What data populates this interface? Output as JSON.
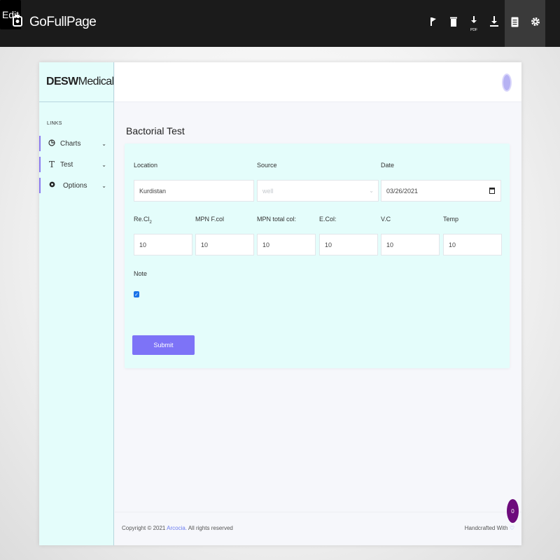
{
  "toolbar": {
    "brand": "GoFullPage",
    "edit_label": "Edit",
    "pdf_label": "PDF",
    "icons": [
      "camera-icon",
      "flag-icon",
      "trash-icon",
      "download-pdf-icon",
      "download-icon",
      "file-icon",
      "gear-icon"
    ]
  },
  "app": {
    "logo_bold": "DESW",
    "logo_rest": "Medical",
    "sidebar": {
      "section_label": "LINKS",
      "items": [
        {
          "label": "Charts",
          "icon": "pie-chart-icon"
        },
        {
          "label": "Test",
          "icon": "text-icon"
        },
        {
          "label": "Options",
          "icon": "gear-icon"
        }
      ]
    },
    "page_title": "Bactorial Test",
    "form": {
      "location": {
        "label": "Location",
        "value": "Kurdistan"
      },
      "source": {
        "label": "Source",
        "value": "well"
      },
      "date": {
        "label": "Date",
        "value": "03/26/2021"
      },
      "measurements": [
        {
          "label": "Re.Cl",
          "sub": "2",
          "value": "10"
        },
        {
          "label": "MPN F.col",
          "sub": "",
          "value": "10"
        },
        {
          "label": "MPN total col:",
          "sub": "",
          "value": "10"
        },
        {
          "label": "E.Col:",
          "sub": "",
          "value": "10"
        },
        {
          "label": "V.C",
          "sub": "",
          "value": "10"
        },
        {
          "label": "Temp",
          "sub": "",
          "value": "10"
        }
      ],
      "note_label": "Note",
      "note_checked": true,
      "submit_label": "Submit"
    },
    "footer": {
      "copyright_prefix": "Copyright © 2021",
      "company": "Arcocia.",
      "rights": "All rights reserved",
      "handcrafted": "Handcrafted With"
    },
    "badge": "0"
  },
  "colors": {
    "sidebar_bg": "#e4fdfb",
    "accent": "#7d73f7",
    "toolbar_bg": "#1b1b1b",
    "badge": "#6d0b7c"
  }
}
